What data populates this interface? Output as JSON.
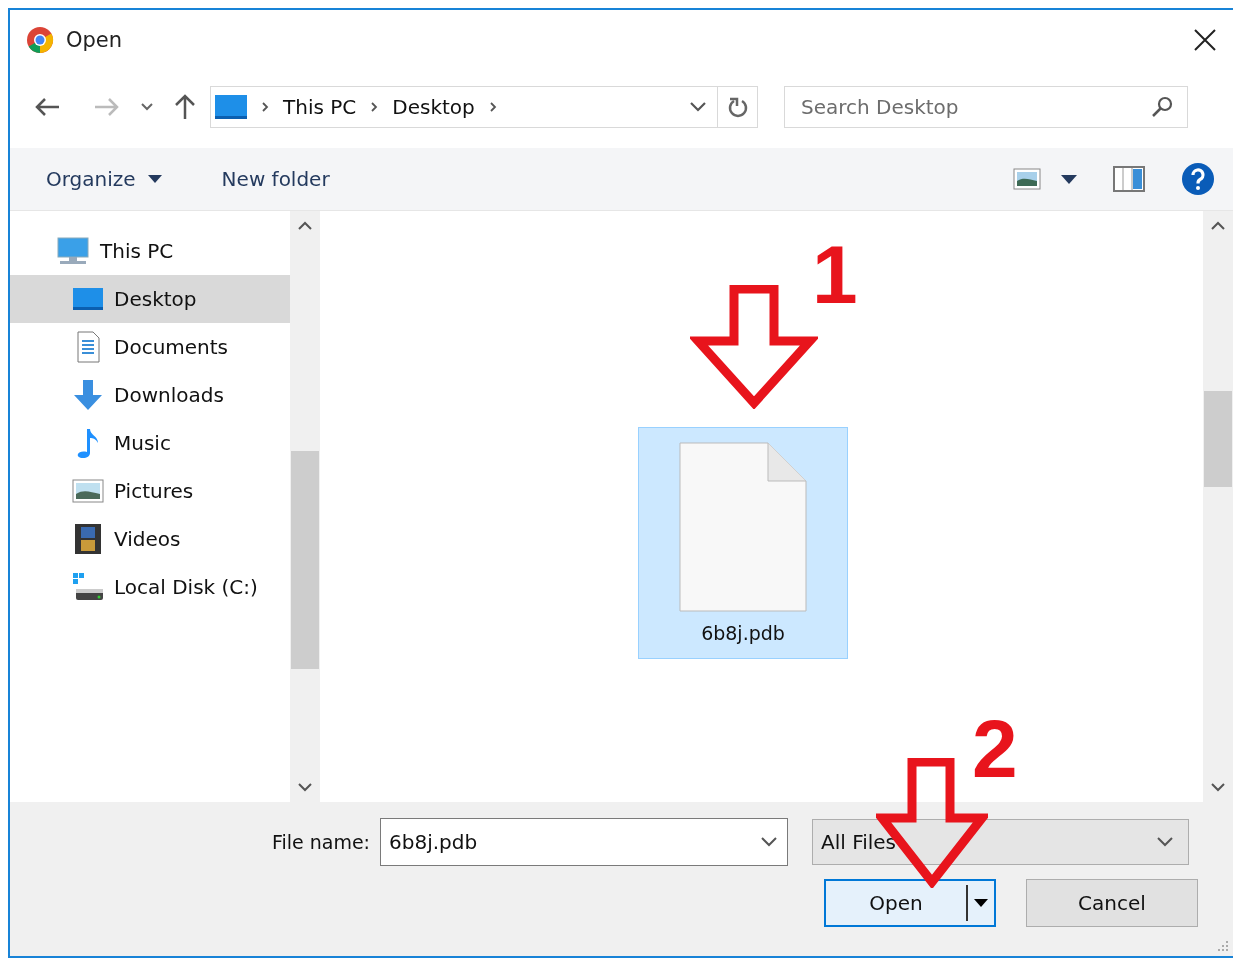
{
  "window": {
    "title": "Open"
  },
  "navigation": {
    "breadcrumb": [
      "This PC",
      "Desktop"
    ],
    "search": {
      "placeholder": "Search Desktop"
    }
  },
  "toolbar": {
    "buttons": [
      "Organize",
      "New folder"
    ]
  },
  "sidebar": {
    "items": [
      {
        "label": "This PC",
        "kind": "pc",
        "selected": false,
        "children": [
          {
            "label": "Desktop",
            "kind": "desktop",
            "selected": true
          },
          {
            "label": "Documents",
            "kind": "documents",
            "selected": false
          },
          {
            "label": "Downloads",
            "kind": "downloads",
            "selected": false
          },
          {
            "label": "Music",
            "kind": "music",
            "selected": false
          },
          {
            "label": "Pictures",
            "kind": "pictures",
            "selected": false
          },
          {
            "label": "Videos",
            "kind": "videos",
            "selected": false
          },
          {
            "label": "Local Disk (C:)",
            "kind": "disk",
            "selected": false
          }
        ]
      }
    ]
  },
  "files": [
    {
      "name": "6b8j.pdb",
      "selected": true
    }
  ],
  "annotations": [
    {
      "label": "1"
    },
    {
      "label": "2"
    }
  ],
  "file_name": {
    "label": "File name:",
    "value": "6b8j.pdb"
  },
  "file_type": {
    "value": "All Files"
  },
  "buttons": [
    "Open",
    "Cancel"
  ]
}
